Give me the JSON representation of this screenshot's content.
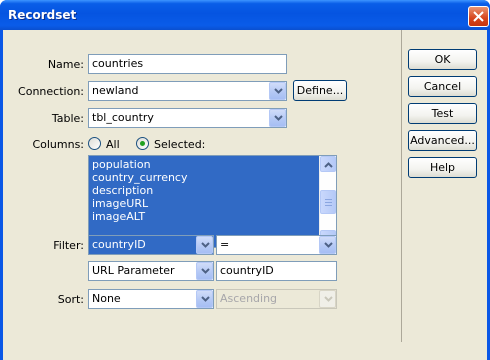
{
  "window": {
    "title": "Recordset"
  },
  "form": {
    "name_label": "Name:",
    "name_value": "countries",
    "connection_label": "Connection:",
    "connection_value": "newland",
    "define_label": "Define...",
    "table_label": "Table:",
    "table_value": "tbl_country",
    "columns_label": "Columns:",
    "columns_all_label": "All",
    "columns_selected_label": "Selected:",
    "columns_selected_choice": "Selected",
    "columns_items": [
      "population",
      "country_currency",
      "description",
      "imageURL",
      "imageALT"
    ],
    "filter_label": "Filter:",
    "filter_column": "countryID",
    "filter_operator": "=",
    "filter_source": "URL Parameter",
    "filter_param": "countryID",
    "sort_label": "Sort:",
    "sort_column": "None",
    "sort_order": "Ascending"
  },
  "buttons": {
    "ok": "OK",
    "cancel": "Cancel",
    "test": "Test",
    "advanced": "Advanced...",
    "help": "Help"
  },
  "colors": {
    "title_bar": "#0a5ee8",
    "dialog_bg": "#ece9d8",
    "selection": "#316ac5",
    "close_button": "#d6441c"
  },
  "icons": {
    "close": "close-icon",
    "dropdown": "chevron-down-icon",
    "scroll_up": "scroll-up-icon",
    "scroll_down": "scroll-down-icon"
  }
}
